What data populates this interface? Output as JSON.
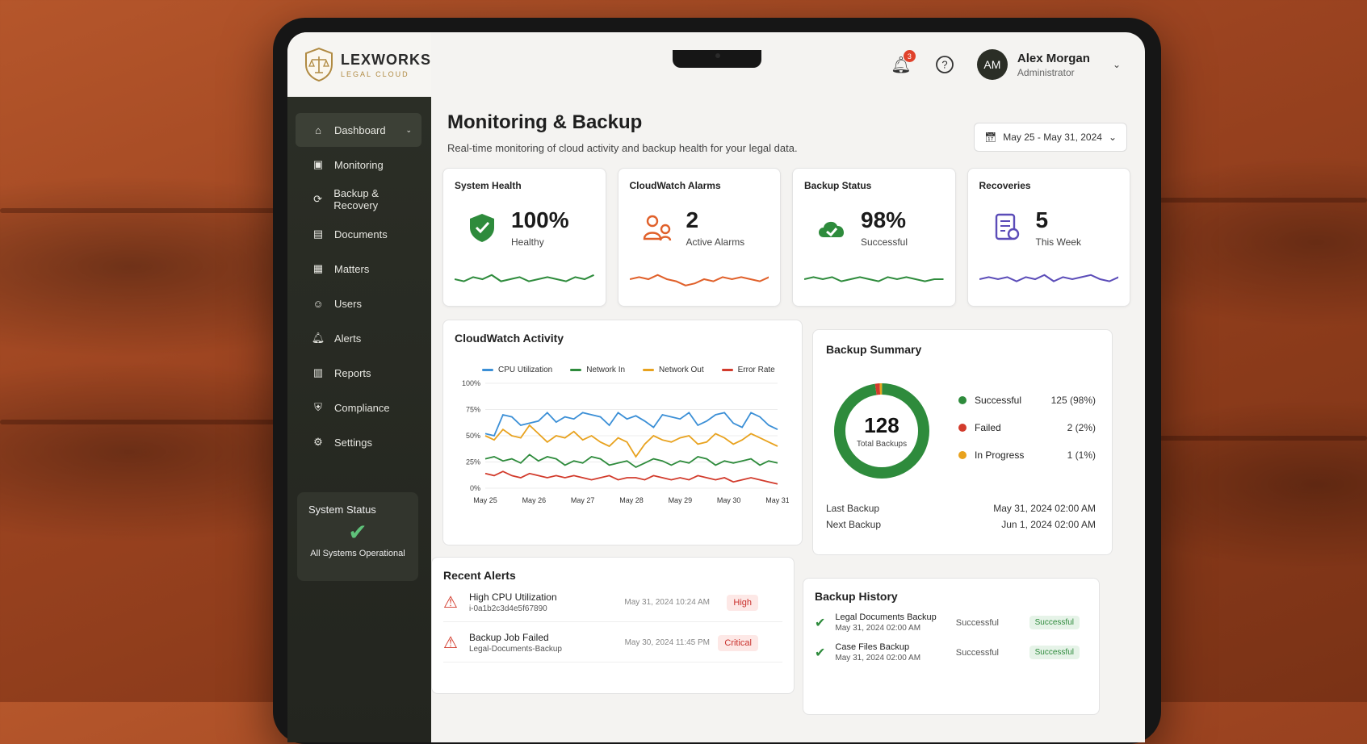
{
  "brand": {
    "name": "LEXWORKS",
    "subtitle": "LEGAL CLOUD"
  },
  "sidebar": {
    "items": [
      {
        "label": "Dashboard",
        "icon": "dashboard-icon",
        "active": true
      },
      {
        "label": "Monitoring",
        "icon": "monitor-icon"
      },
      {
        "label": "Backup & Recovery",
        "icon": "backup-icon"
      },
      {
        "label": "Documents",
        "icon": "document-icon"
      },
      {
        "label": "Matters",
        "icon": "briefcase-icon"
      },
      {
        "label": "Users",
        "icon": "users-icon"
      },
      {
        "label": "Alerts",
        "icon": "bell-icon"
      },
      {
        "label": "Reports",
        "icon": "report-icon"
      },
      {
        "label": "Compliance",
        "icon": "shield-icon"
      },
      {
        "label": "Settings",
        "icon": "gear-icon"
      }
    ],
    "status": {
      "title": "System Status",
      "text": "All Systems Operational"
    }
  },
  "topbar": {
    "notifications": "3",
    "user": {
      "initials": "AM",
      "name": "Alex Morgan",
      "role": "Administrator"
    }
  },
  "page": {
    "title": "Monitoring & Backup",
    "subtitle": "Real-time monitoring of cloud activity and backup health for your legal data.",
    "date_range": "May 25 - May 31, 2024"
  },
  "cards": [
    {
      "title": "System Health",
      "value": "100%",
      "label": "Healthy",
      "color": "#2e8b3c",
      "spark": [
        5,
        4,
        6,
        5,
        7,
        4,
        5,
        6,
        4,
        5,
        6,
        5,
        4,
        6,
        5,
        7
      ]
    },
    {
      "title": "CloudWatch Alarms",
      "value": "2",
      "label": "Active Alarms",
      "color": "#e0602a",
      "spark": [
        5,
        6,
        5,
        7,
        5,
        4,
        2,
        3,
        5,
        4,
        6,
        5,
        6,
        5,
        4,
        6
      ]
    },
    {
      "title": "Backup Status",
      "value": "98%",
      "label": "Successful",
      "color": "#2e8b3c",
      "spark": [
        5,
        6,
        5,
        6,
        4,
        5,
        6,
        5,
        4,
        6,
        5,
        6,
        5,
        4,
        5,
        5
      ]
    },
    {
      "title": "Recoveries",
      "value": "5",
      "label": "This Week",
      "color": "#5b4cb8",
      "spark": [
        5,
        6,
        5,
        6,
        4,
        6,
        5,
        7,
        4,
        6,
        5,
        6,
        7,
        5,
        4,
        6
      ]
    }
  ],
  "activity": {
    "title": "CloudWatch Activity",
    "series": [
      {
        "name": "CPU Utilization",
        "color": "#3b8fd6",
        "values": [
          52,
          50,
          70,
          68,
          60,
          62,
          64,
          72,
          63,
          68,
          66,
          72,
          70,
          68,
          60,
          72,
          66,
          69,
          64,
          58,
          70,
          68,
          66,
          72,
          60,
          64,
          70,
          72,
          62,
          58,
          72,
          68,
          60,
          56
        ]
      },
      {
        "name": "Network In",
        "color": "#2e8b3c",
        "values": [
          28,
          30,
          26,
          28,
          24,
          32,
          26,
          30,
          28,
          22,
          26,
          24,
          30,
          28,
          22,
          24,
          26,
          20,
          24,
          28,
          26,
          22,
          26,
          24,
          30,
          28,
          22,
          26,
          24,
          26,
          28,
          22,
          26,
          24
        ]
      },
      {
        "name": "Network Out",
        "color": "#e8a21e",
        "values": [
          50,
          46,
          56,
          50,
          48,
          60,
          52,
          44,
          50,
          48,
          54,
          46,
          50,
          44,
          40,
          48,
          44,
          30,
          42,
          50,
          46,
          44,
          48,
          50,
          42,
          44,
          52,
          48,
          42,
          46,
          52,
          48,
          44,
          40
        ]
      },
      {
        "name": "Error Rate",
        "color": "#d23b2c",
        "values": [
          14,
          12,
          16,
          12,
          10,
          14,
          12,
          10,
          12,
          10,
          12,
          10,
          8,
          10,
          12,
          8,
          10,
          10,
          8,
          12,
          10,
          8,
          10,
          8,
          12,
          10,
          8,
          10,
          6,
          8,
          10,
          8,
          6,
          4
        ]
      }
    ],
    "y_ticks": [
      "100%",
      "75%",
      "50%",
      "25%",
      "0%"
    ],
    "x_ticks": [
      "May 25",
      "May 26",
      "May 27",
      "May 28",
      "May 29",
      "May 30",
      "May 31"
    ]
  },
  "chart_data": {
    "type": "line",
    "title": "CloudWatch Activity",
    "ylim": [
      0,
      100
    ],
    "x": [
      "May 25",
      "May 26",
      "May 27",
      "May 28",
      "May 29",
      "May 30",
      "May 31"
    ],
    "series": [
      {
        "name": "CPU Utilization",
        "values": [
          52,
          65,
          68,
          66,
          62,
          68,
          56
        ]
      },
      {
        "name": "Network In",
        "values": [
          28,
          28,
          24,
          22,
          26,
          26,
          24
        ]
      },
      {
        "name": "Network Out",
        "values": [
          50,
          52,
          46,
          34,
          46,
          48,
          40
        ]
      },
      {
        "name": "Error Rate",
        "values": [
          14,
          12,
          10,
          10,
          10,
          8,
          4
        ]
      }
    ]
  },
  "summary": {
    "title": "Backup Summary",
    "total": "128",
    "total_label": "Total Backups",
    "items": [
      {
        "label": "Successful",
        "value": "125 (98%)",
        "color": "#2e8b3c",
        "count": 125
      },
      {
        "label": "Failed",
        "value": "2 (2%)",
        "color": "#d23b2c",
        "count": 2
      },
      {
        "label": "In Progress",
        "value": "1 (1%)",
        "color": "#e8a21e",
        "count": 1
      }
    ],
    "last_label": "Last Backup",
    "last_value": "May 31, 2024 02:00 AM",
    "next_label": "Next Backup",
    "next_value": "Jun 1, 2024 02:00 AM"
  },
  "alerts": {
    "title": "Recent Alerts",
    "items": [
      {
        "title": "High CPU Utilization",
        "sub": "i-0a1b2c3d4e5f67890",
        "time": "May 31, 2024 10:24 AM",
        "severity": "High"
      },
      {
        "title": "Backup Job Failed",
        "sub": "Legal-Documents-Backup",
        "time": "May 30, 2024 11:45 PM",
        "severity": "Critical"
      }
    ]
  },
  "history": {
    "title": "Backup History",
    "items": [
      {
        "title": "Legal Documents Backup",
        "sub": "May 31, 2024 02:00 AM",
        "status": "Successful",
        "pill": "Successful"
      },
      {
        "title": "Case Files Backup",
        "sub": "May 31, 2024 02:00 AM",
        "status": "Successful",
        "pill": "Successful"
      }
    ]
  }
}
